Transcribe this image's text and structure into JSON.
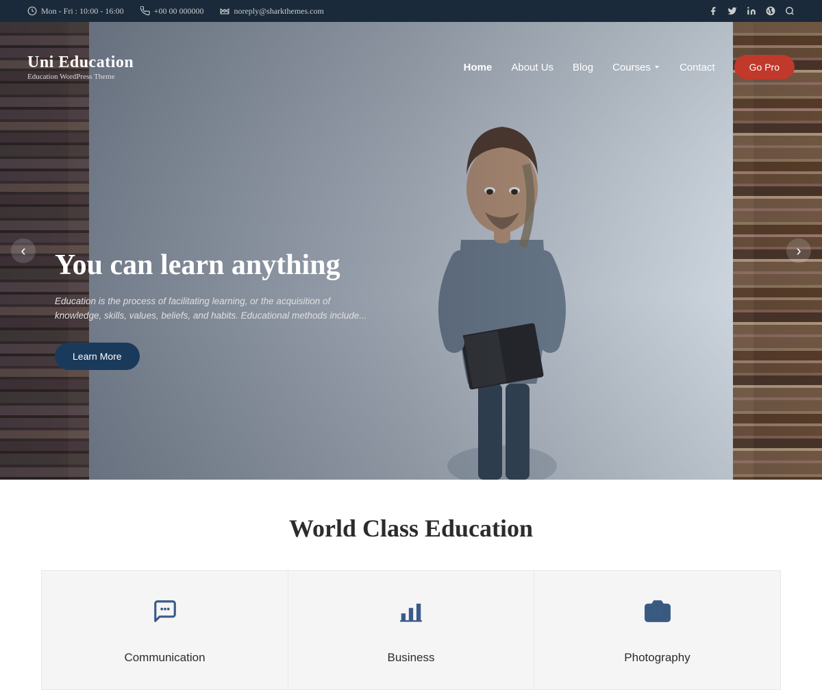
{
  "topbar": {
    "hours": "Mon - Fri : 10:00 - 16:00",
    "phone": "+00 00 000000",
    "email": "noreply@sharkthemes.com",
    "social": [
      "facebook",
      "twitter",
      "linkedin",
      "wordpress",
      "search"
    ]
  },
  "logo": {
    "title": "Uni Education",
    "subtitle": "Education WordPress Theme"
  },
  "nav": {
    "links": [
      {
        "label": "Home",
        "active": true
      },
      {
        "label": "About Us"
      },
      {
        "label": "Blog"
      },
      {
        "label": "Courses",
        "hasDropdown": true
      },
      {
        "label": "Contact"
      }
    ],
    "cta_label": "Go Pro"
  },
  "hero": {
    "title": "You can learn anything",
    "description": "Education is the process of facilitating learning, or the acquisition of knowledge, skills, values, beliefs, and habits. Educational methods include...",
    "cta_label": "Learn More"
  },
  "section": {
    "title": "World Class Education",
    "cards": [
      {
        "id": "communication",
        "label": "Communication",
        "icon": "chat"
      },
      {
        "id": "business",
        "label": "Business",
        "icon": "chart"
      },
      {
        "id": "photography",
        "label": "Photography",
        "icon": "camera"
      }
    ]
  }
}
